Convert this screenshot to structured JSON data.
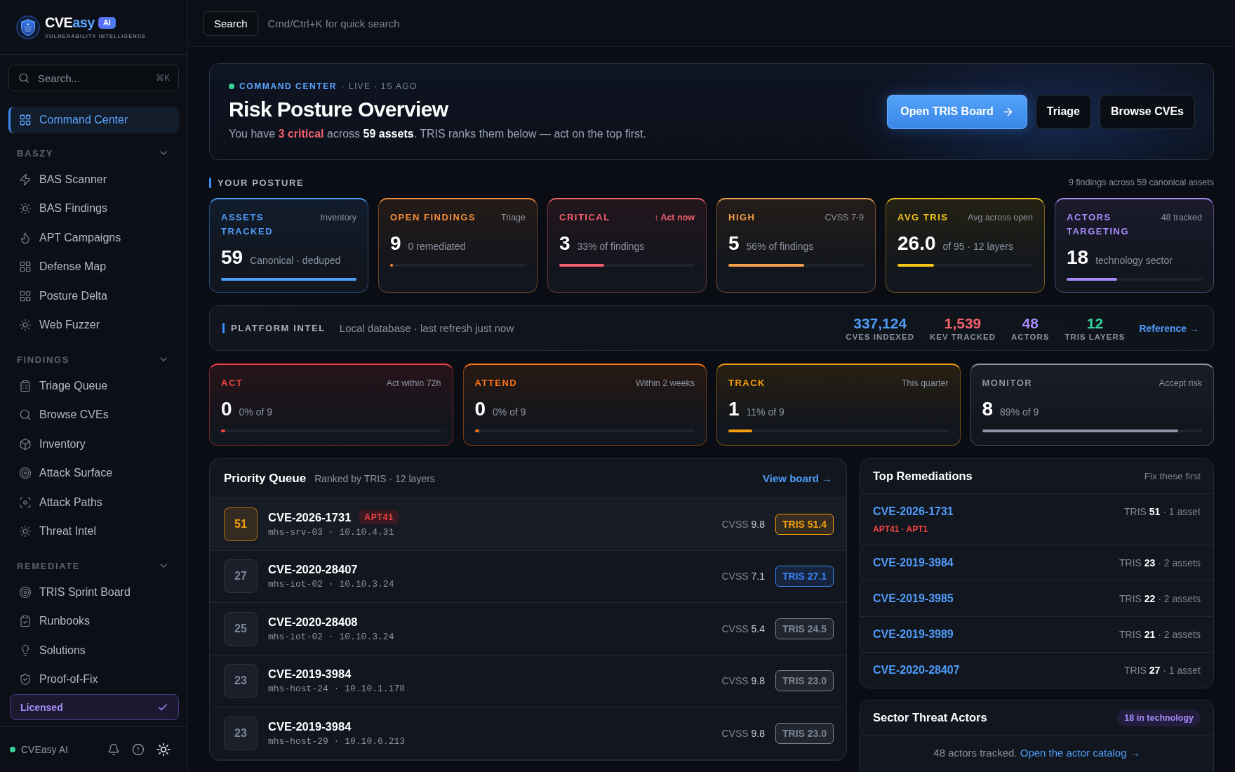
{
  "sidebar": {
    "brand": {
      "primary": "CVE",
      "accent": "asy",
      "badge": "AI",
      "tagline": "VULNERABILITY INTELLIGENCE"
    },
    "search": {
      "placeholder": "Search...",
      "shortcut": "⌘K"
    },
    "home": {
      "label": "Command Center",
      "selected": true
    },
    "sections": [
      {
        "title": "BASZY",
        "expanded": true,
        "items": [
          {
            "label": "BAS Scanner",
            "selected": false
          },
          {
            "label": "BAS Findings",
            "selected": false
          },
          {
            "label": "APT Campaigns",
            "selected": false
          },
          {
            "label": "Defense Map",
            "selected": false
          },
          {
            "label": "Posture Delta",
            "selected": false
          },
          {
            "label": "Web Fuzzer",
            "selected": false
          }
        ]
      },
      {
        "title": "FINDINGS",
        "expanded": true,
        "items": [
          {
            "label": "Triage Queue",
            "selected": false
          },
          {
            "label": "Browse CVEs",
            "selected": false
          },
          {
            "label": "Inventory",
            "selected": false
          },
          {
            "label": "Attack Surface",
            "selected": false
          },
          {
            "label": "Attack Paths",
            "selected": false
          },
          {
            "label": "Threat Intel",
            "selected": false
          }
        ]
      },
      {
        "title": "REMEDIATE",
        "expanded": true,
        "items": [
          {
            "label": "TRIS Sprint Board",
            "selected": false
          },
          {
            "label": "Runbooks",
            "selected": false
          },
          {
            "label": "Solutions",
            "selected": false
          },
          {
            "label": "Proof-of-Fix",
            "selected": false
          }
        ]
      }
    ],
    "license": {
      "label": "Licensed"
    },
    "footer": {
      "label": "CVEasy AI",
      "online": true
    }
  },
  "topbar": {
    "search_button": "Search",
    "hint": "Cmd/Ctrl+K for quick search"
  },
  "hero": {
    "eyebrow": "COMMAND CENTER",
    "status": "· LIVE · 1S AGO",
    "live": true,
    "title": "Risk Posture Overview",
    "summary": "You have **3 critical** across **59 assets**. TRIS ranks them below — act on the top first.",
    "actions": [
      {
        "label": "Open TRIS Board",
        "kind": "primary"
      },
      {
        "label": "Triage",
        "kind": "secondary"
      },
      {
        "label": "Browse CVEs",
        "kind": "secondary"
      }
    ]
  },
  "posture": {
    "title": "YOUR POSTURE",
    "note": "9 findings across 59 canonical assets",
    "cards": [
      {
        "label": "ASSETS TRACKED",
        "tag": "Inventory",
        "urgent": false,
        "value": "59",
        "caption": "Canonical · deduped",
        "level": 1,
        "color": "#4f9cf9"
      },
      {
        "label": "OPEN FINDINGS",
        "tag": "Triage",
        "urgent": false,
        "value": "9",
        "caption": "0 remediated",
        "level": 0.02,
        "color": "#f28c38"
      },
      {
        "label": "CRITICAL",
        "tag": "↑ Act now",
        "urgent": true,
        "value": "3",
        "caption": "33% of findings",
        "level": 0.33,
        "color": "#f0616d"
      },
      {
        "label": "HIGH",
        "tag": "CVSS 7-9",
        "urgent": false,
        "value": "5",
        "caption": "56% of findings",
        "level": 0.56,
        "color": "#f5a04a"
      },
      {
        "label": "AVG TRIS",
        "tag": "Avg across open",
        "urgent": false,
        "value": "26.0",
        "caption": "of 95 · 12 layers",
        "level": 0.27,
        "color": "#f5c518"
      },
      {
        "label": "ACTORS TARGETING",
        "tag": "48 tracked",
        "urgent": false,
        "value": "18",
        "caption": "technology sector",
        "level": 0.375,
        "color": "#a78bfa"
      }
    ]
  },
  "platform_intel": {
    "title": "PLATFORM INTEL",
    "note": "Local database · last refresh just now",
    "stats": [
      {
        "value": "337,124",
        "label": "CVES INDEXED",
        "color": "#4f9cf9"
      },
      {
        "value": "1,539",
        "label": "KEV TRACKED",
        "color": "#f0616d"
      },
      {
        "value": "48",
        "label": "ACTORS",
        "color": "#a78bfa"
      },
      {
        "value": "12",
        "label": "TRIS LAYERS",
        "color": "#34d399"
      }
    ],
    "link": "Reference →"
  },
  "tiers": [
    {
      "label": "ACT",
      "tag": "Act within 72h",
      "value": "0",
      "caption": "0% of 9",
      "level": 0.02,
      "color": "#ef4444"
    },
    {
      "label": "ATTEND",
      "tag": "Within 2 weeks",
      "value": "0",
      "caption": "0% of 9",
      "level": 0.02,
      "color": "#f97316"
    },
    {
      "label": "TRACK",
      "tag": "This quarter",
      "value": "1",
      "caption": "11% of 9",
      "level": 0.11,
      "color": "#f59e0b"
    },
    {
      "label": "MONITOR",
      "tag": "Accept risk",
      "value": "8",
      "caption": "89% of 9",
      "level": 0.89,
      "color": "#8b95a5"
    }
  ],
  "priority_queue": {
    "title": "Priority Queue",
    "subtitle": "Ranked by TRIS · 12 layers",
    "link": "View board →",
    "rows": [
      {
        "rank": "51",
        "cve": "CVE-2026-1731",
        "actor": "APT41",
        "host": "mhs-srv-03 · 10.10.4.31",
        "cvss_label": "CVSS",
        "cvss": "9.8",
        "tris": "TRIS 51.4",
        "color": "#f59e0b",
        "highlighted": true
      },
      {
        "rank": "27",
        "cve": "CVE-2020-28407",
        "host": "mhs-iot-02 · 10.10.3.24",
        "cvss_label": "CVSS",
        "cvss": "7.1",
        "tris": "TRIS 27.1",
        "color": "#3b82f6",
        "highlighted": false
      },
      {
        "rank": "25",
        "cve": "CVE-2020-28408",
        "host": "mhs-iot-02 · 10.10.3.24",
        "cvss_label": "CVSS",
        "cvss": "5.4",
        "tris": "TRIS 24.5",
        "color": "#7c8595",
        "highlighted": false
      },
      {
        "rank": "23",
        "cve": "CVE-2019-3984",
        "host": "mhs-host-24 · 10.10.1.178",
        "cvss_label": "CVSS",
        "cvss": "9.8",
        "tris": "TRIS 23.0",
        "color": "#7c8595",
        "highlighted": false
      },
      {
        "rank": "23",
        "cve": "CVE-2019-3984",
        "host": "mhs-host-29 · 10.10.6.213",
        "cvss_label": "CVSS",
        "cvss": "9.8",
        "tris": "TRIS 23.0",
        "color": "#7c8595",
        "highlighted": false
      }
    ]
  },
  "top_remediations": {
    "title": "Top Remediations",
    "note": "Fix these first",
    "items": [
      {
        "cve": "CVE-2026-1731",
        "actors": "APT41 · APT1",
        "meta": "TRIS **51** · 1 asset"
      },
      {
        "cve": "CVE-2019-3984",
        "meta": "TRIS **23** · 2 assets"
      },
      {
        "cve": "CVE-2019-3985",
        "meta": "TRIS **22** · 2 assets"
      },
      {
        "cve": "CVE-2019-3989",
        "meta": "TRIS **21** · 2 assets"
      },
      {
        "cve": "CVE-2020-28407",
        "meta": "TRIS **27** · 1 asset"
      }
    ]
  },
  "sector_threat_actors": {
    "title": "Sector Threat Actors",
    "badge": "18 in technology",
    "text": "48 actors tracked.",
    "link": "Open the actor catalog →"
  }
}
